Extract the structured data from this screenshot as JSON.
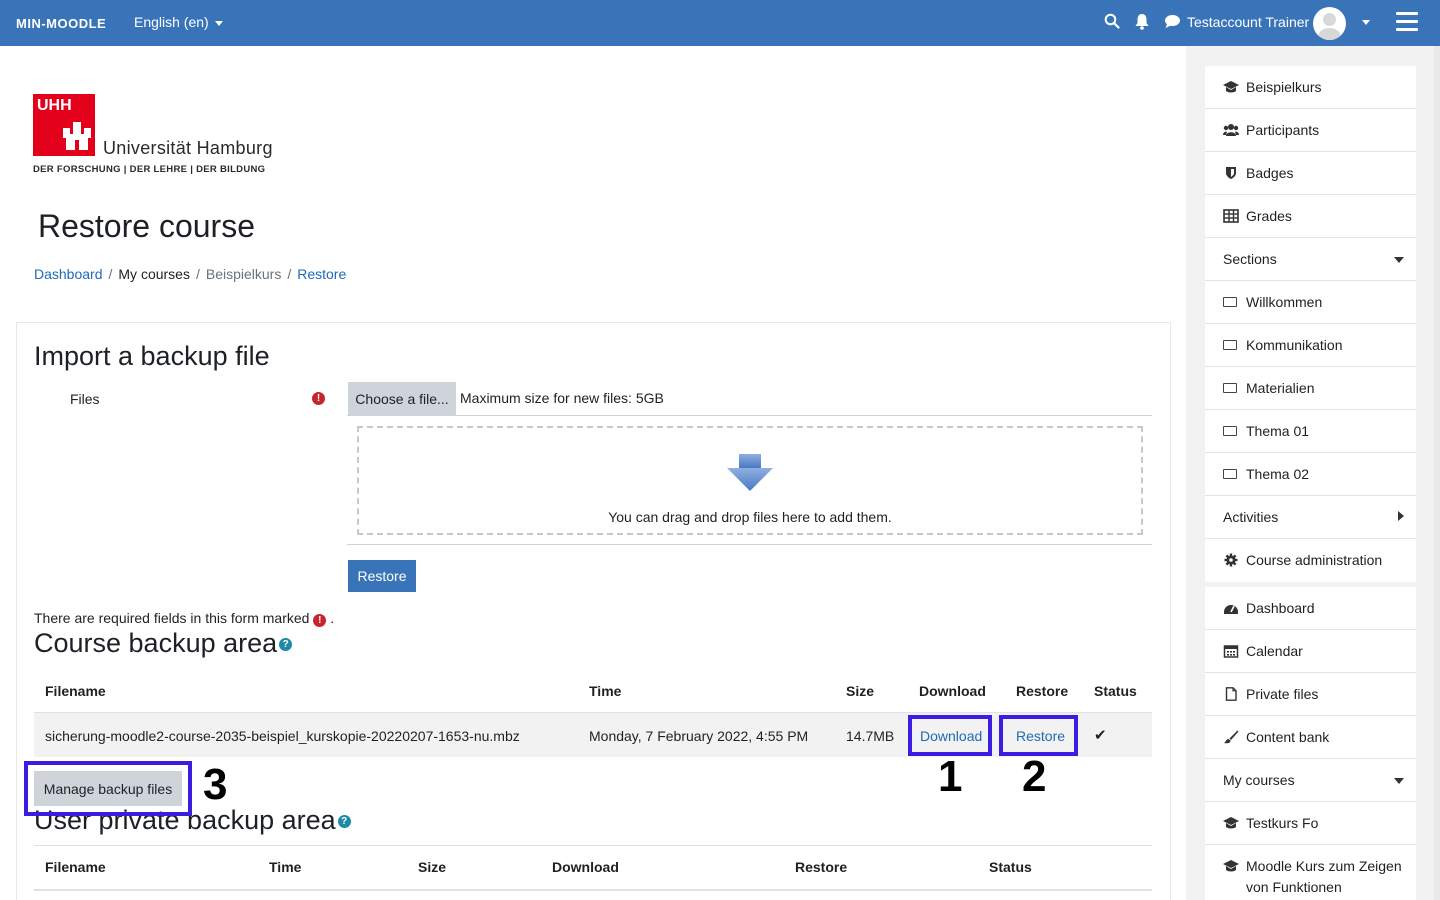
{
  "navbar": {
    "brand": "MIN-MOODLE",
    "language": "English (en)",
    "user_name": "Testaccount Trainer"
  },
  "logo": {
    "mark": "UHH",
    "name": "Universität Hamburg",
    "tagline": "DER FORSCHUNG | DER LEHRE | DER BILDUNG"
  },
  "page": {
    "title": "Restore course",
    "breadcrumb": [
      "Dashboard",
      "My courses",
      "Beispielkurs",
      "Restore"
    ]
  },
  "import": {
    "heading": "Import a backup file",
    "files_label": "Files",
    "choose_label": "Choose a file...",
    "max_size": "Maximum size for new files: 5GB",
    "drop_text": "You can drag and drop files here to add them.",
    "restore_label": "Restore",
    "required_note": "There are required fields in this form marked",
    "required_note_end": "."
  },
  "course_backup": {
    "heading": "Course backup area",
    "columns": [
      "Filename",
      "Time",
      "Size",
      "Download",
      "Restore",
      "Status"
    ],
    "rows": [
      {
        "filename": "sicherung-moodle2-course-2035-beispiel_kurskopie-20220207-1653-nu.mbz",
        "time": "Monday, 7 February 2022, 4:55 PM",
        "size": "14.7MB",
        "download": "Download",
        "restore": "Restore",
        "status": "✔"
      }
    ],
    "manage_label": "Manage backup files"
  },
  "annotations": [
    "1",
    "2",
    "3"
  ],
  "user_private": {
    "heading": "User private backup area",
    "columns": [
      "Filename",
      "Time",
      "Size",
      "Download",
      "Restore",
      "Status"
    ]
  },
  "sidebar": {
    "course_block": [
      {
        "label": "Beispielkurs",
        "icon": "graduation-cap-icon"
      },
      {
        "label": "Participants",
        "icon": "users-icon"
      },
      {
        "label": "Badges",
        "icon": "shield-icon"
      },
      {
        "label": "Grades",
        "icon": "table-icon"
      },
      {
        "label": "Sections",
        "icon": "",
        "expander": "down"
      },
      {
        "label": "Willkommen",
        "icon": "folder-icon"
      },
      {
        "label": "Kommunikation",
        "icon": "folder-icon"
      },
      {
        "label": "Materialien",
        "icon": "folder-icon"
      },
      {
        "label": "Thema 01",
        "icon": "folder-icon"
      },
      {
        "label": "Thema 02",
        "icon": "folder-icon"
      },
      {
        "label": "Activities",
        "icon": "",
        "expander": "right"
      },
      {
        "label": "Course administration",
        "icon": "gear-icon"
      }
    ],
    "site_block": [
      {
        "label": "Dashboard",
        "icon": "dashboard-icon"
      },
      {
        "label": "Calendar",
        "icon": "calendar-icon"
      },
      {
        "label": "Private files",
        "icon": "file-icon"
      },
      {
        "label": "Content bank",
        "icon": "brush-icon"
      },
      {
        "label": "My courses",
        "icon": "",
        "expander": "down"
      },
      {
        "label": "Testkurs Fo",
        "icon": "graduation-cap-icon"
      },
      {
        "label": "Moodle Kurs zum Zeigen von Funktionen",
        "icon": "graduation-cap-icon"
      }
    ]
  }
}
